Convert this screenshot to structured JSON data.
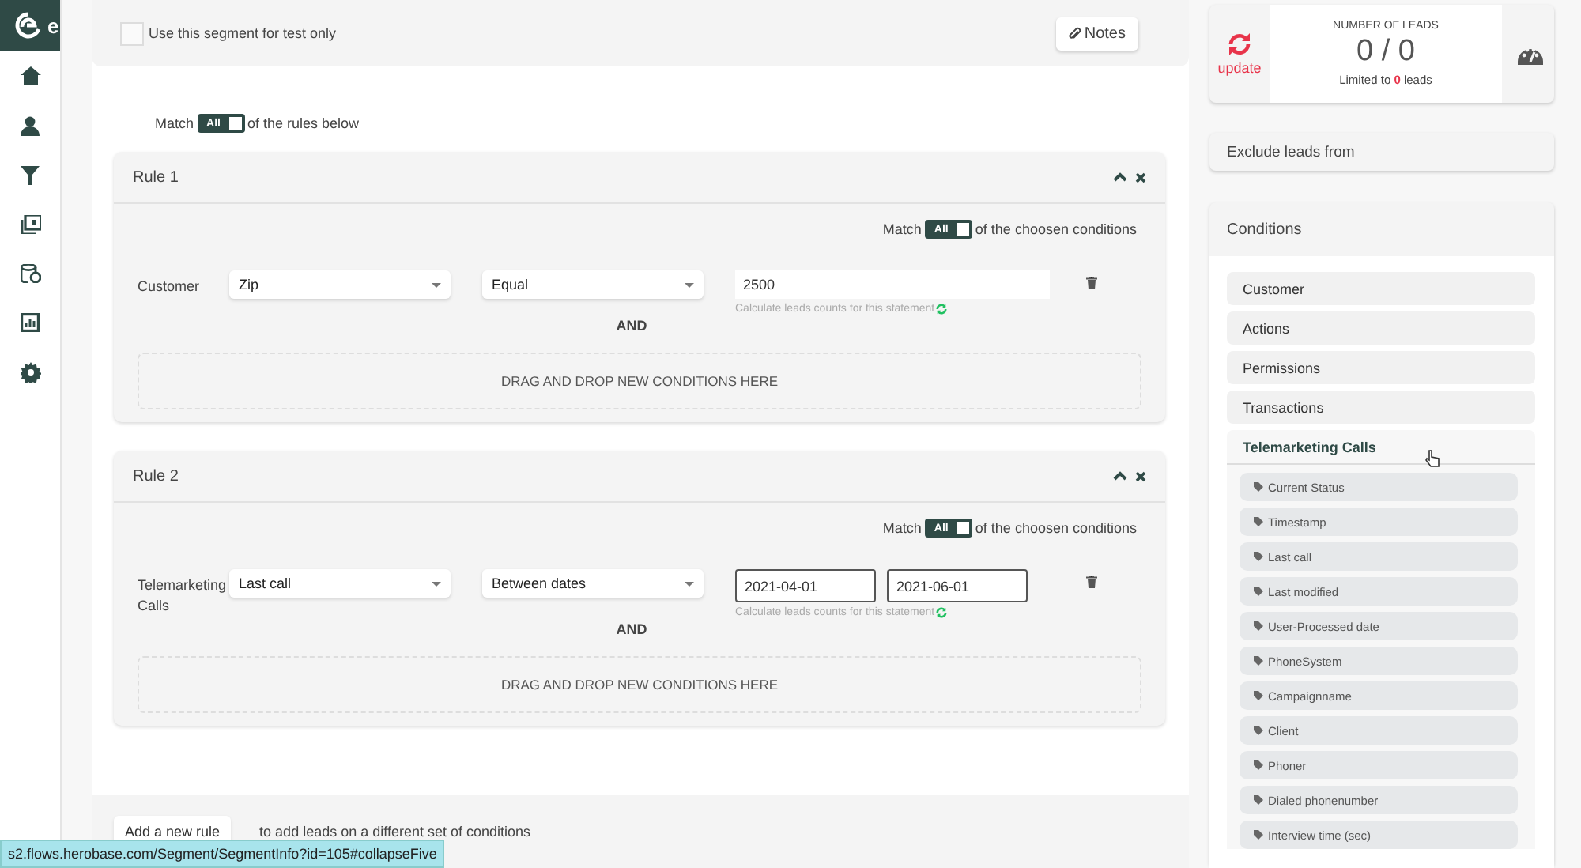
{
  "sidebar": {
    "logo_text": "e"
  },
  "segment": {
    "test_only": {
      "label": "Use this segment for test only",
      "checked": false
    },
    "notes_button": "Notes"
  },
  "match": {
    "prefix": "Match",
    "toggle": {
      "label": "All",
      "on": true
    },
    "suffix": "of the rules below"
  },
  "rules": [
    {
      "title": "Rule 1",
      "match": {
        "prefix": "Match",
        "toggle": {
          "label": "All",
          "on": true
        },
        "suffix": "of the choosen conditions"
      },
      "conditions": [
        {
          "group": "Customer",
          "field": "Zip",
          "operator": "Equal",
          "kind": "text",
          "values": [
            "2500"
          ],
          "hint": "Calculate leads counts for this statement"
        }
      ],
      "and_label": "AND",
      "drop_zone": "DRAG AND DROP NEW CONDITIONS HERE"
    },
    {
      "title": "Rule 2",
      "match": {
        "prefix": "Match",
        "toggle": {
          "label": "All",
          "on": true
        },
        "suffix": "of the choosen conditions"
      },
      "conditions": [
        {
          "group": "Telemarketing Calls",
          "field": "Last call",
          "operator": "Between dates",
          "kind": "date_range",
          "values": [
            "2021-04-01",
            "2021-06-01"
          ],
          "hint": "Calculate leads counts for this statement"
        }
      ],
      "and_label": "AND",
      "drop_zone": "DRAG AND DROP NEW CONDITIONS HERE"
    }
  ],
  "add_rule": {
    "button": "Add a new rule",
    "text": "to add leads on a different set of conditions"
  },
  "leads": {
    "update": "update",
    "title": "NUMBER OF LEADS",
    "count": "0 / 0",
    "limit_prefix": "Limited to",
    "limit_value": "0",
    "limit_suffix": "leads"
  },
  "exclude": {
    "title": "Exclude leads from"
  },
  "conditions": {
    "title": "Conditions",
    "groups": [
      {
        "label": "Customer",
        "expanded": false
      },
      {
        "label": "Actions",
        "expanded": false
      },
      {
        "label": "Permissions",
        "expanded": false
      },
      {
        "label": "Transactions",
        "expanded": false
      },
      {
        "label": "Telemarketing Calls",
        "expanded": true,
        "fields": [
          "Current Status",
          "Timestamp",
          "Last call",
          "Last modified",
          "User-Processed date",
          "PhoneSystem",
          "Campaignname",
          "Client",
          "Phoner",
          "Dialed phonenumber",
          "Interview time (sec)"
        ]
      }
    ]
  },
  "status_bar": {
    "url": "s2.flows.herobase.com/Segment/SegmentInfo?id=105#collapseFive"
  }
}
